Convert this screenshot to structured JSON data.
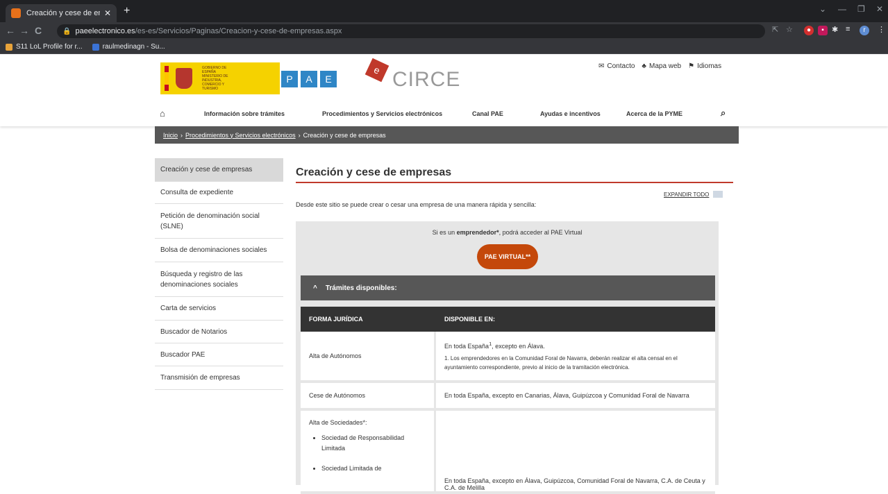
{
  "browser": {
    "tab_title": "Creación y cese de empresas",
    "tab_close": "✕",
    "new_tab": "+",
    "url_host": "paeelectronico.es",
    "url_path": "/es-es/Servicios/Paginas/Creacion-y-cese-de-empresas.aspx",
    "bookmarks": [
      "S11 LoL Profile for r...",
      "raulmedinagn - Su..."
    ]
  },
  "header": {
    "gob_text": "GOBIERNO DE ESPAÑA   MINISTERIO DE INDUSTRIA, COMERCIO Y TURISMO",
    "pae_letters": [
      "P",
      "A",
      "E"
    ],
    "circe": "CIRCE",
    "toplinks": {
      "contacto": "Contacto",
      "mapa": "Mapa web",
      "idiomas": "Idiomas"
    },
    "nav": [
      "Información sobre trámites",
      "Procedimientos y Servicios electrónicos",
      "Canal PAE",
      "Ayudas e incentivos",
      "Acerca de la PYME"
    ]
  },
  "breadcrumb": {
    "inicio": "Inicio",
    "procedimientos": "Procedimientos y Servicios electrónicos",
    "current": "Creación y cese de empresas"
  },
  "sidebar": {
    "items": [
      "Creación y cese de empresas",
      "Consulta de expediente",
      "Petición de denominación social (SLNE)",
      "Bolsa de denominaciones sociales",
      "Búsqueda y registro de las denominaciones sociales",
      "Carta de servicios",
      "Buscador de Notarios",
      "Buscador PAE",
      "Transmisión de empresas"
    ]
  },
  "main": {
    "title": "Creación y cese de empresas",
    "expandir": "EXPANDIR TODO",
    "intro": "Desde este sitio se puede crear o cesar una empresa de una manera rápida y sencilla:",
    "empr_pre": "Si es un ",
    "empr_bold": "emprendedor*",
    "empr_post": ", podrá acceder al PAE Virtual",
    "pae_button": "PAE VIRTUAL**",
    "accordion": "Trámites disponibles:",
    "table": {
      "headers": [
        "FORMA JURÍDICA",
        "DISPONIBLE EN:"
      ],
      "row1": {
        "c1": "Alta de Autónomos",
        "c2_main": "En toda España",
        "c2_sup": "1",
        "c2_tail": ", excepto en Álava.",
        "c2_note": "1. Los emprendedores en la Comunidad Foral de Navarra, deberán realizar el alta censal en el ayuntamiento correspondiente, previo al inicio de la tramitación electrónica."
      },
      "row2": {
        "c1": "Cese de Autónomos",
        "c2": "En toda España, excepto en Canarias, Álava, Guipúzcoa y Comunidad Foral de Navarra"
      },
      "row3": {
        "c1": "Alta de Sociedades*:",
        "list": [
          "Sociedad de Responsabilidad Limitada",
          "Sociedad Limitada de"
        ],
        "c2": "En toda España, excepto en Álava, Guipúzcoa, Comunidad Foral de Navarra, C.A. de Ceuta y C.A. de Melilla"
      }
    }
  }
}
